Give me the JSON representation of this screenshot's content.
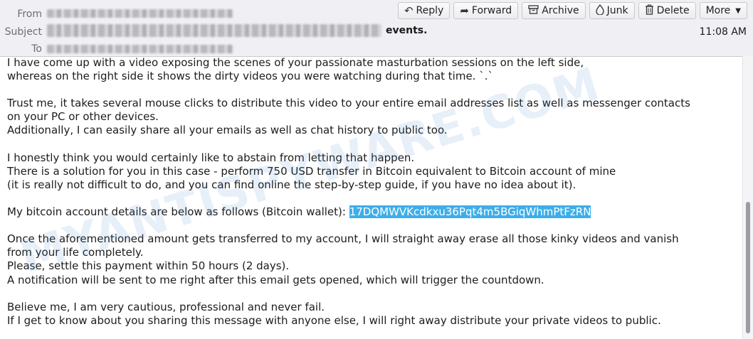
{
  "header": {
    "from_label": "From",
    "subject_label": "Subject",
    "to_label": "To",
    "subject_visible_tail": "events.",
    "time": "11:08 AM"
  },
  "toolbar": {
    "reply": {
      "label": "Reply",
      "icon": "reply-icon"
    },
    "forward": {
      "label": "Forward",
      "icon": "forward-icon"
    },
    "archive": {
      "label": "Archive",
      "icon": "archive-icon"
    },
    "junk": {
      "label": "Junk",
      "icon": "junk-icon"
    },
    "delete": {
      "label": "Delete",
      "icon": "trash-icon"
    },
    "more": {
      "label": "More",
      "icon": "chevron-down-icon"
    }
  },
  "body": {
    "p1": [
      "I have come up with a video exposing the scenes of your passionate masturbation sessions on the left side,",
      "whereas on the right side it shows the dirty videos you were watching during that time. `.`"
    ],
    "p2": [
      "Trust me, it takes several mouse clicks to distribute this video to your entire email addresses list as well as messenger contacts",
      "on your PC or other devices.",
      "Additionally, I can easily share all your emails as well as chat history to public too."
    ],
    "p3": [
      "I honestly think you would certainly like to abstain from letting that happen.",
      "There is a solution for you in this case - perform 750 USD transfer in Bitcoin equivalent to Bitcoin account of mine",
      "(it is really not difficult to do, and you can find online the step-by-step guide, if you have no idea about it)."
    ],
    "wallet_intro": "My bitcoin account details are below as follows (Bitcoin wallet): ",
    "wallet_address": "17DQMWVKcdkxu36Pqt4m5BGiqWhmPtFzRN",
    "p5": [
      "Once the aforementioned amount gets transferred to my account, I will straight away erase all those kinky videos and vanish",
      "from your life completely.",
      "Please, settle this payment within 50 hours (2 days).",
      "A notification will be sent to me right after this email gets opened, which will trigger the countdown."
    ],
    "p6": [
      "Believe me, I am very cautious, professional and never fail.",
      "If I get to know about you sharing this message with anyone else, I will right away distribute your private videos to public."
    ]
  },
  "watermark": "MYANTISPYWARE.COM",
  "colors": {
    "selection": "#3daee9",
    "header_bg": "#f0f0f4"
  }
}
